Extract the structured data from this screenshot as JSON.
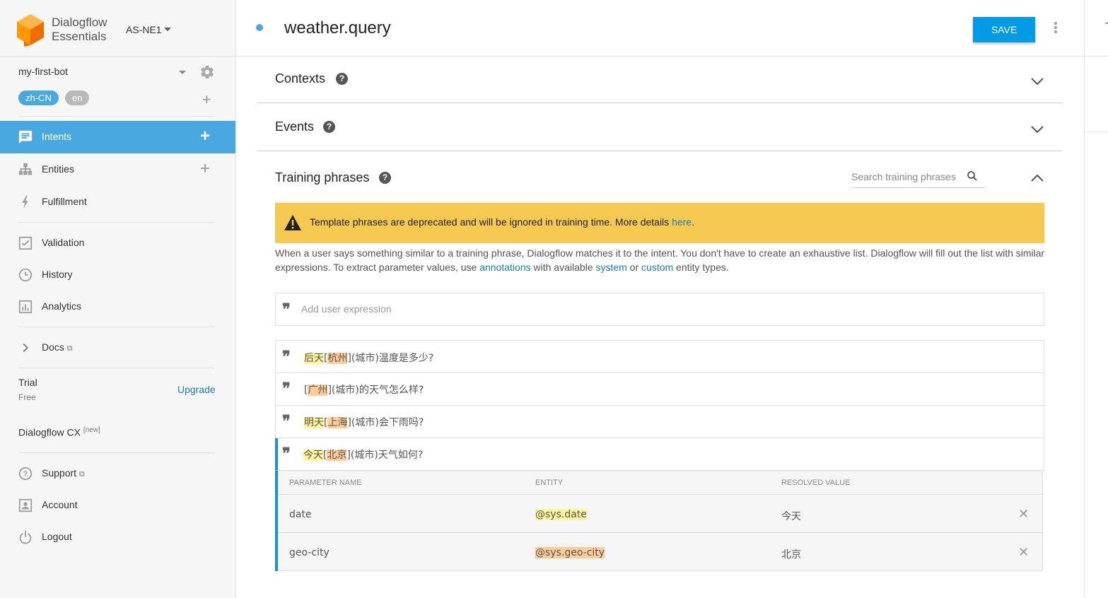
{
  "brand": {
    "line1": "Dialogflow",
    "line2": "Essentials",
    "region": "AS-NE1"
  },
  "agent": {
    "name": "my-first-bot",
    "languages": [
      "zh-CN",
      "en"
    ]
  },
  "nav": {
    "intents": "Intents",
    "entities": "Entities",
    "fulfillment": "Fulfillment",
    "validation": "Validation",
    "history": "History",
    "analytics": "Analytics",
    "docs": "Docs",
    "support": "Support",
    "account": "Account",
    "logout": "Logout"
  },
  "plan": {
    "name": "Trial",
    "tier": "Free",
    "upgrade": "Upgrade"
  },
  "cx": {
    "label": "Dialogflow CX",
    "badge": "[new]"
  },
  "header": {
    "intent_name": "weather.query",
    "save_label": "SAVE",
    "right_tab_letter": "T"
  },
  "sections": {
    "contexts": "Contexts",
    "events": "Events",
    "training": "Training phrases",
    "help": "?"
  },
  "search": {
    "placeholder": "Search training phrases"
  },
  "warning": {
    "text": "Template phrases are deprecated and will be ignored in training time. More details ",
    "link": "here",
    "end": "."
  },
  "description": {
    "part1": "When a user says something similar to a training phrase, Dialogflow matches it to the intent. You don't have to create an exhaustive list. Dialogflow will fill out the list with similar expressions. To extract parameter values, use ",
    "link_annotations": "annotations",
    "part2": " with available ",
    "link_system": "system",
    "part3": " or ",
    "link_custom": "custom",
    "part4": " entity types."
  },
  "expression_input": {
    "placeholder": "Add user expression"
  },
  "quote_glyph": "❞",
  "phrases": [
    {
      "date": "后天",
      "open": "[",
      "city": "杭州",
      "rest": "](城市)温度是多少?"
    },
    {
      "open": "[",
      "city": "广州",
      "rest": "](城市)的天气怎么样?"
    },
    {
      "date": "明天",
      "open": "[",
      "city": "上海",
      "rest": "](城市)会下雨吗?"
    },
    {
      "date": "今天",
      "open": "[",
      "city": "北京",
      "rest": "](城市)天气如何?"
    }
  ],
  "parameters": {
    "headers": {
      "name": "PARAMETER NAME",
      "entity": "ENTITY",
      "value": "RESOLVED VALUE"
    },
    "rows": [
      {
        "name": "date",
        "entity": "@sys.date",
        "value": "今天"
      },
      {
        "name": "geo-city",
        "entity": "@sys.geo-city",
        "value": "北京"
      }
    ],
    "remove_glyph": "✕"
  },
  "colors": {
    "accent": "#4aa8e1",
    "save": "#039be5",
    "warning": "#f5c94f",
    "link": "#1a7bc1",
    "date_highlight": "#fff59d",
    "city_highlight": "#ffcc99",
    "logo": "#ef6c00"
  },
  "icons": {
    "plus": "+",
    "chevron_right": "›",
    "external": "⧉"
  }
}
